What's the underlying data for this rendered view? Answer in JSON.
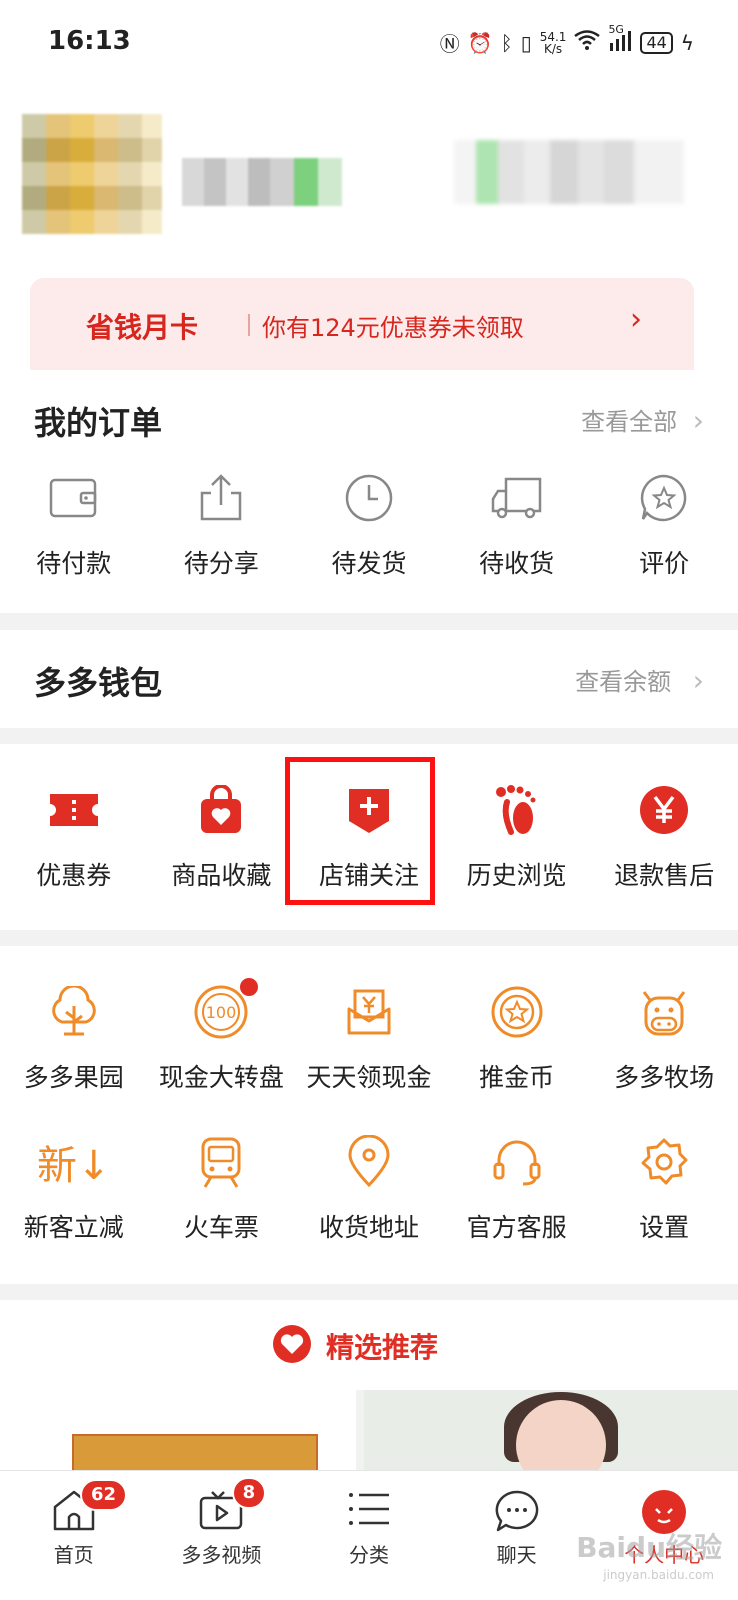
{
  "status_bar": {
    "time": "16:13",
    "net_speed_top": "54.1",
    "net_speed_bottom": "K/s",
    "signal": "5G",
    "battery": "44",
    "icons": [
      "nfc-icon",
      "alarm-icon",
      "bluetooth-icon",
      "vibrate-icon",
      "wifi-icon",
      "signal-icon",
      "battery-icon",
      "charging-icon"
    ]
  },
  "promo_card": {
    "title": "省钱月卡",
    "description": "你有124元优惠券未领取",
    "arrow": "›"
  },
  "orders": {
    "title": "我的订单",
    "view_all": "查看全部",
    "chevron": "›",
    "items": [
      {
        "label": "待付款",
        "icon": "wallet-icon"
      },
      {
        "label": "待分享",
        "icon": "share-icon"
      },
      {
        "label": "待发货",
        "icon": "clock-icon"
      },
      {
        "label": "待收货",
        "icon": "truck-icon"
      },
      {
        "label": "评价",
        "icon": "star-chat-icon"
      }
    ]
  },
  "wallet": {
    "title": "多多钱包",
    "view_balance": "查看余额",
    "chevron": "›"
  },
  "services": {
    "items": [
      {
        "label": "优惠券",
        "icon": "ticket-icon"
      },
      {
        "label": "商品收藏",
        "icon": "bag-heart-icon"
      },
      {
        "label": "店铺关注",
        "icon": "store-plus-icon"
      },
      {
        "label": "历史浏览",
        "icon": "footprint-icon"
      },
      {
        "label": "退款售后",
        "icon": "yen-circle-icon"
      }
    ],
    "accent_color": "#e02e24"
  },
  "tools": {
    "row1": [
      {
        "label": "多多果园",
        "icon": "tree-icon"
      },
      {
        "label": "现金大转盘",
        "icon": "wheel-100-icon"
      },
      {
        "label": "天天领现金",
        "icon": "yen-envelope-icon"
      },
      {
        "label": "推金币",
        "icon": "coin-icon"
      },
      {
        "label": "多多牧场",
        "icon": "cow-icon"
      }
    ],
    "row2": [
      {
        "label": "新客立减",
        "icon": "new-down-icon",
        "glyph": "新↓"
      },
      {
        "label": "火车票",
        "icon": "train-icon"
      },
      {
        "label": "收货地址",
        "icon": "location-icon"
      },
      {
        "label": "官方客服",
        "icon": "headset-icon"
      },
      {
        "label": "设置",
        "icon": "gear-icon"
      }
    ],
    "accent_color": "#f08b2a"
  },
  "recommend": {
    "title": "精选推荐",
    "icon": "heart-badge-icon"
  },
  "tab_bar": {
    "tabs": [
      {
        "label": "首页",
        "icon": "home-icon",
        "badge": "62"
      },
      {
        "label": "多多视频",
        "icon": "video-icon",
        "badge": "8"
      },
      {
        "label": "分类",
        "icon": "list-icon"
      },
      {
        "label": "聊天",
        "icon": "chat-icon"
      },
      {
        "label": "个人中心",
        "icon": "profile-icon"
      }
    ],
    "active_color": "#e02e24"
  },
  "watermark": {
    "text": "Baidu经验",
    "sub": "jingyan.baidu.com"
  }
}
